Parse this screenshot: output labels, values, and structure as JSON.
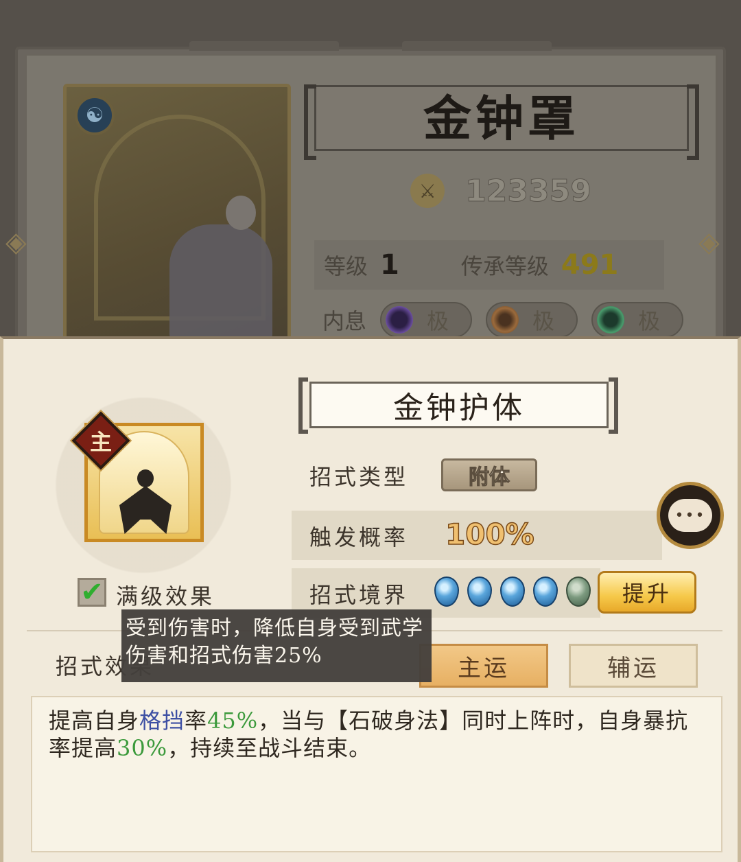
{
  "background_card": {
    "title": "金钟罩",
    "power": "123359",
    "level_label": "等级",
    "level_value": "1",
    "inherit_label": "传承等级",
    "inherit_value": "491",
    "neixi_label": "内息",
    "neixi_pills": [
      "极",
      "极",
      "极"
    ],
    "element_icon": "taichi-icon"
  },
  "skill": {
    "name": "金钟护体",
    "main_badge": "主",
    "type_label": "招式类型",
    "type_value": "附体",
    "trigger_label": "触发概率",
    "trigger_value": "100%",
    "realm_label": "招式境界",
    "realm_level": 4,
    "realm_max": 5,
    "upgrade_label": "提升",
    "max_effect_label": "满级效果",
    "max_effect_checked": true,
    "effect_label": "招式效果",
    "tooltip": "受到伤害时，降低自身受到武学伤害和招式伤害25%",
    "main_fortune_label": "主运",
    "aux_fortune_label": "辅运",
    "description": {
      "p1": "提高自身",
      "p2": "格挡",
      "p3": "率",
      "p4": "45%",
      "p5": "，当与【石破身法】同时上阵时，自身暴抗率提高",
      "p6": "30%",
      "p7": "，持续至战斗结束。"
    }
  },
  "colors": {
    "popup_bg": "#f1eadb",
    "accent_gold": "#e9bf55",
    "highlight_blue": "#3d4fa3",
    "highlight_green": "#3c9a3c"
  }
}
